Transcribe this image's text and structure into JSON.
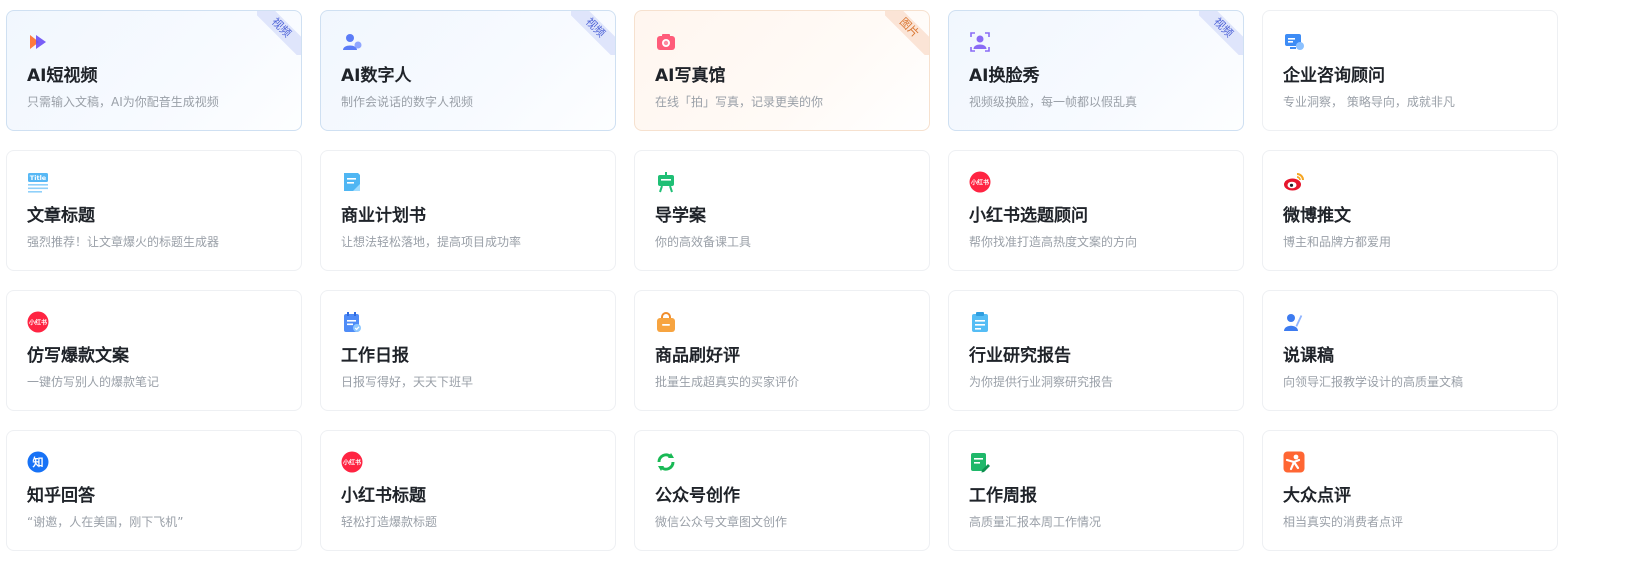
{
  "cards": [
    {
      "title": "AI短视频",
      "desc": "只需输入文稿，AI为你配音生成视频",
      "badge": "视频",
      "icon": "video-play-icon"
    },
    {
      "title": "AI数字人",
      "desc": "制作会说话的数字人视频",
      "badge": "视频",
      "icon": "digital-human-icon"
    },
    {
      "title": "AI写真馆",
      "desc": "在线「拍」写真，记录更美的你",
      "badge": "图片",
      "icon": "camera-icon"
    },
    {
      "title": "AI换脸秀",
      "desc": "视频级换脸，每一帧都以假乱真",
      "badge": "视频",
      "icon": "face-swap-icon"
    },
    {
      "title": "企业咨询顾问",
      "desc": "专业洞察， 策略导向，成就非凡",
      "badge": "",
      "icon": "consulting-icon"
    },
    {
      "title": "文章标题",
      "desc": "强烈推荐！让文章爆火的标题生成器",
      "badge": "",
      "icon": "title-icon"
    },
    {
      "title": "商业计划书",
      "desc": "让想法轻松落地，提高项目成功率",
      "badge": "",
      "icon": "plan-document-icon"
    },
    {
      "title": "导学案",
      "desc": "你的高效备课工具",
      "badge": "",
      "icon": "teaching-board-icon"
    },
    {
      "title": "小红书选题顾问",
      "desc": "帮你找准打造高热度文案的方向",
      "badge": "",
      "icon": "xiaohongshu-icon"
    },
    {
      "title": "微博推文",
      "desc": "博主和品牌方都爱用",
      "badge": "",
      "icon": "weibo-icon"
    },
    {
      "title": "仿写爆款文案",
      "desc": "一键仿写别人的爆款笔记",
      "badge": "",
      "icon": "xiaohongshu-icon"
    },
    {
      "title": "工作日报",
      "desc": "日报写得好，天天下班早",
      "badge": "",
      "icon": "daily-report-icon"
    },
    {
      "title": "商品刷好评",
      "desc": "批量生成超真实的买家评价",
      "badge": "",
      "icon": "shopping-bag-icon"
    },
    {
      "title": "行业研究报告",
      "desc": "为你提供行业洞察研究报告",
      "badge": "",
      "icon": "research-report-icon"
    },
    {
      "title": "说课稿",
      "desc": "向领导汇报教学设计的高质量文稿",
      "badge": "",
      "icon": "lecture-icon"
    },
    {
      "title": "知乎回答",
      "desc": "“谢邀，人在美国，刚下飞机”",
      "badge": "",
      "icon": "zhihu-icon"
    },
    {
      "title": "小红书标题",
      "desc": "轻松打造爆款标题",
      "badge": "",
      "icon": "xiaohongshu-icon"
    },
    {
      "title": "公众号创作",
      "desc": "微信公众号文章图文创作",
      "badge": "",
      "icon": "wechat-official-icon"
    },
    {
      "title": "工作周报",
      "desc": "高质量汇报本周工作情况",
      "badge": "",
      "icon": "weekly-report-icon"
    },
    {
      "title": "大众点评",
      "desc": "相当真实的消费者点评",
      "badge": "",
      "icon": "dianping-icon"
    }
  ],
  "icon_labels": {
    "title": "Title",
    "xiaohongshu": "小红书",
    "zhihu": "知"
  },
  "colors": {
    "title_text": "#1f2329",
    "desc_text": "#9aa0a8",
    "video_badge": "#4a5fd6",
    "image_badge": "#d9752f",
    "xiaohongshu_red": "#ff2442",
    "zhihu_blue": "#1772f6"
  }
}
